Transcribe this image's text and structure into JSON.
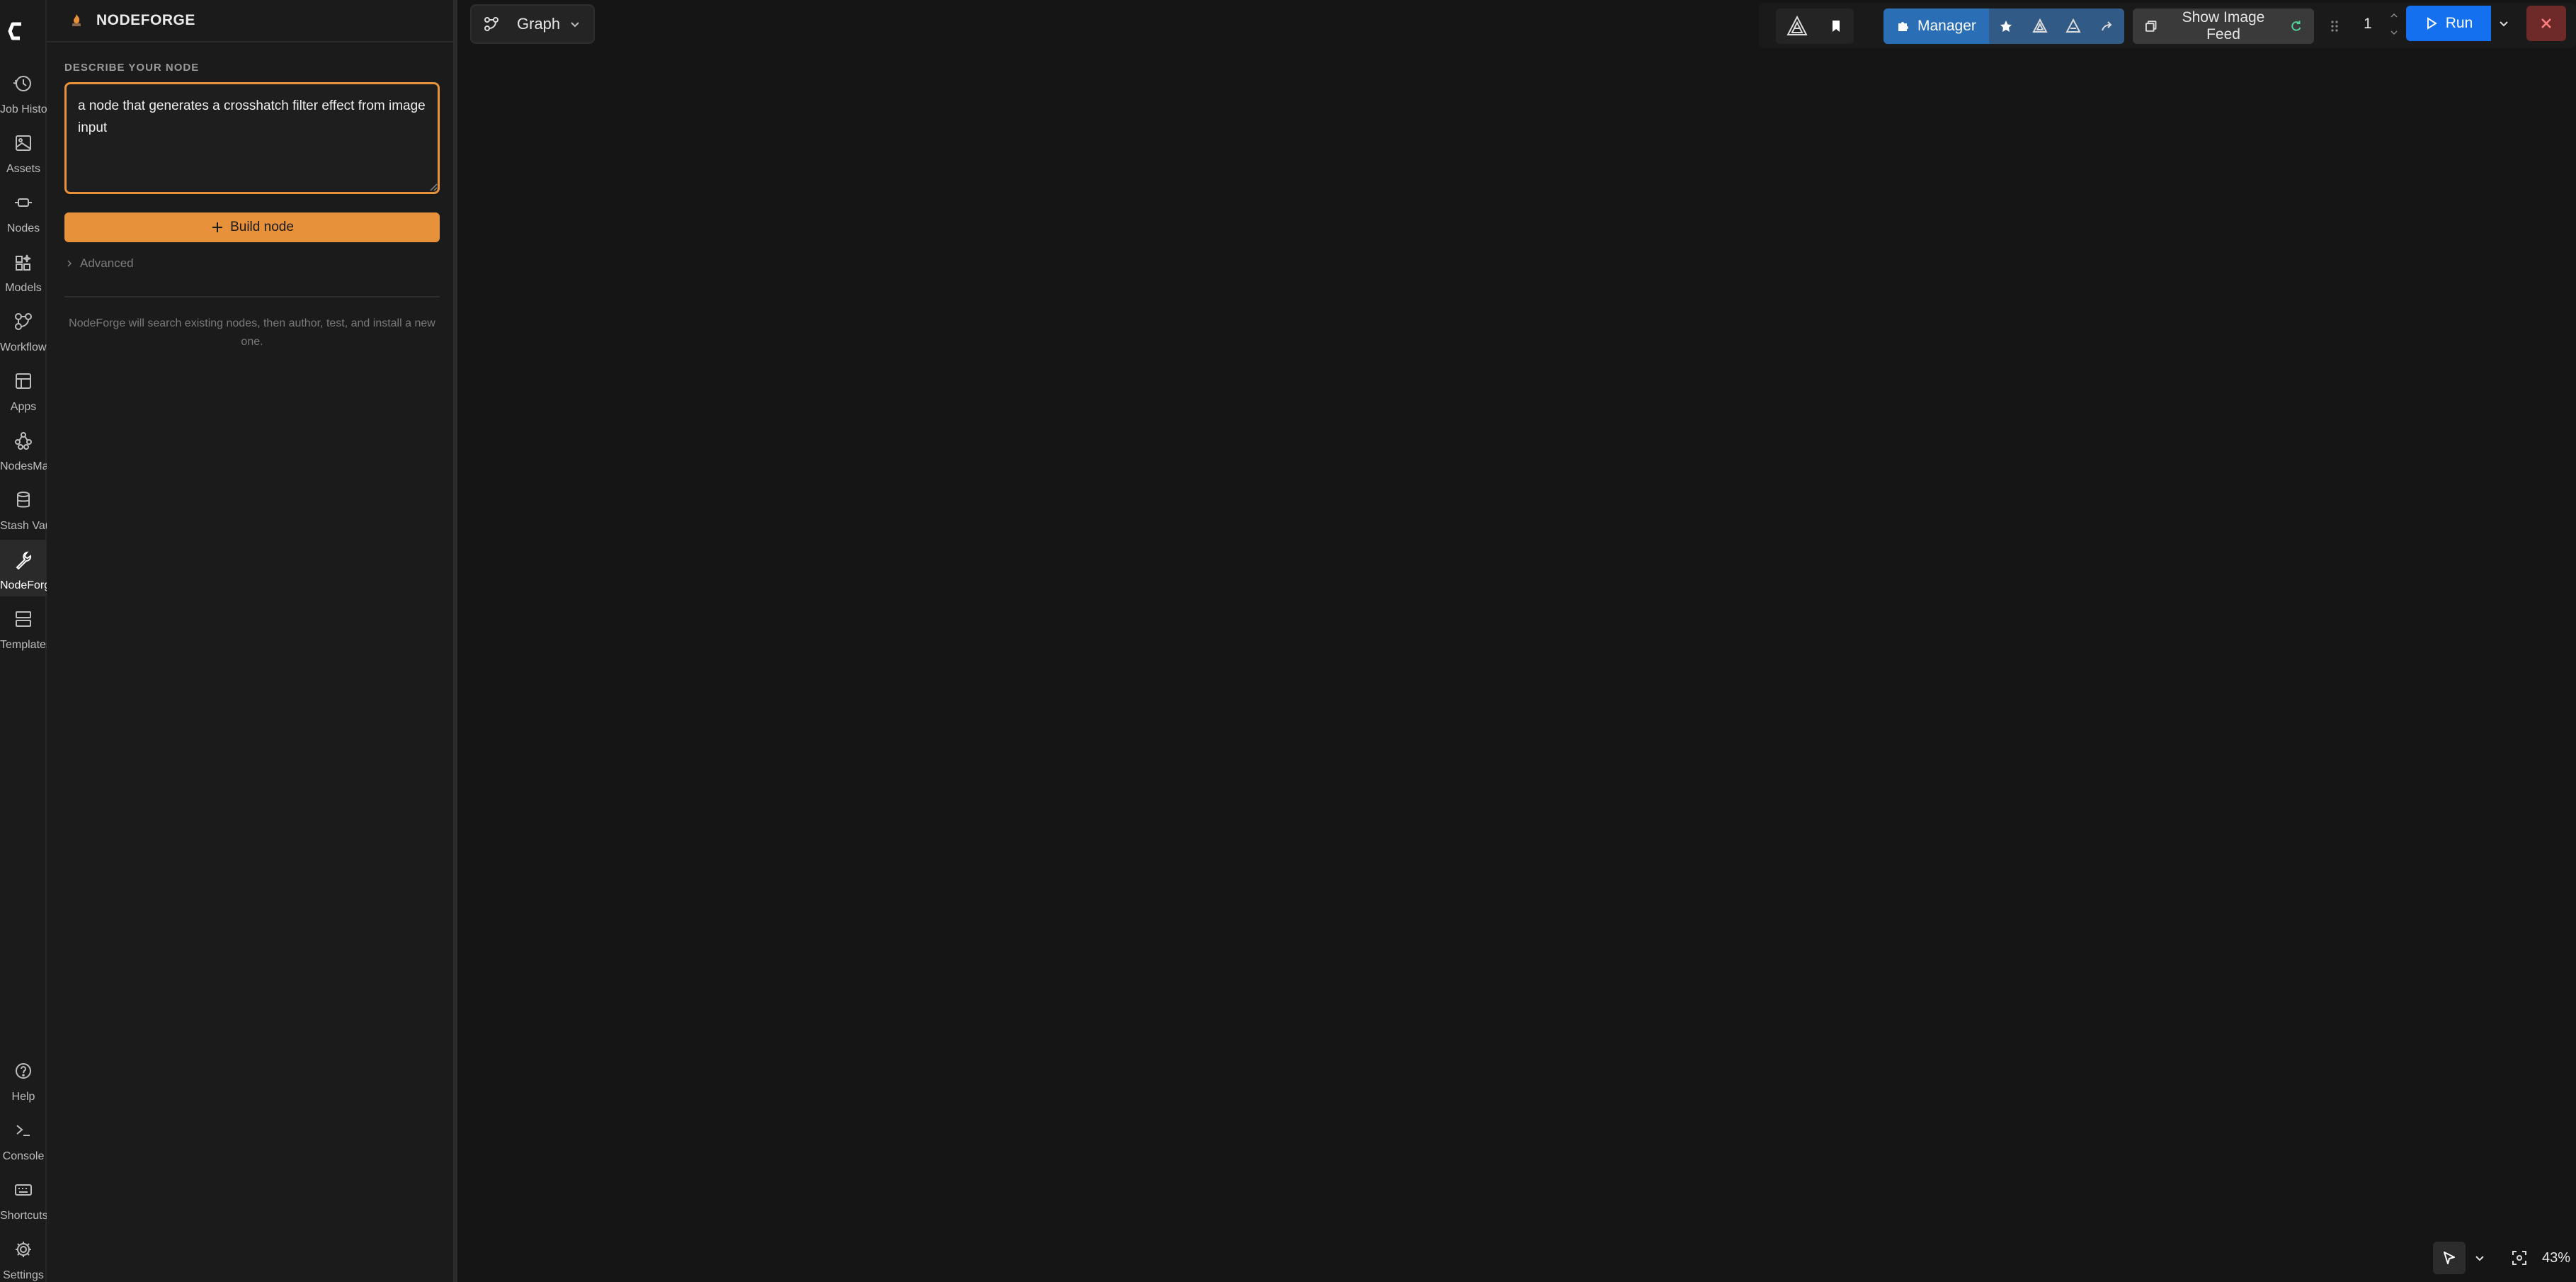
{
  "rail": {
    "logo": "comfy-logo-icon",
    "items": [
      {
        "label": "Job History",
        "icon": "history-icon"
      },
      {
        "label": "Assets",
        "icon": "image-icon"
      },
      {
        "label": "Nodes",
        "icon": "node-icon"
      },
      {
        "label": "Models",
        "icon": "models-icon"
      },
      {
        "label": "Workflows",
        "icon": "workflow-icon"
      },
      {
        "label": "Apps",
        "icon": "apps-icon"
      },
      {
        "label": "NodesMap",
        "icon": "nodes-map-icon"
      },
      {
        "label": "Stash Vault",
        "icon": "database-icon"
      },
      {
        "label": "NodeForge",
        "icon": "wrench-icon",
        "active": true
      },
      {
        "label": "Templates",
        "icon": "templates-icon"
      }
    ],
    "bottom_items": [
      {
        "label": "Help",
        "icon": "help-icon"
      },
      {
        "label": "Console",
        "icon": "terminal-icon"
      },
      {
        "label": "Shortcuts",
        "icon": "keyboard-icon"
      },
      {
        "label": "Settings",
        "icon": "gear-icon"
      }
    ]
  },
  "panel": {
    "title": "NODEFORGE",
    "describe_label": "DESCRIBE YOUR NODE",
    "describe_value": "a node that generates a crosshatch filter effect from image input",
    "build_label": "Build node",
    "advanced_label": "Advanced",
    "helper_text": "NodeForge will search existing nodes, then author, test, and install a new one."
  },
  "canvas": {
    "tab_label": "Graph"
  },
  "toolbar": {
    "manager_label": "Manager",
    "feed_label": "Show Image Feed",
    "queue_count": "1",
    "run_label": "Run"
  },
  "bottom": {
    "zoom_level": "43%"
  },
  "colors": {
    "accent": "#e7913a",
    "run_blue": "#1570ef",
    "manager_blue": "#2a6fb5",
    "close_red": "#6e2929"
  }
}
